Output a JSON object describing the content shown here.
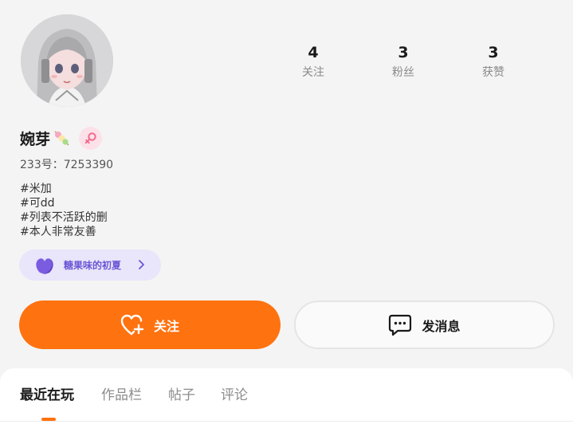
{
  "profile": {
    "name": "婉芽",
    "uid_label": "233号：7253390",
    "gender": "female",
    "tags": [
      "#米加",
      "#可dd",
      "#列表不活跃的删",
      "#本人非常友善"
    ]
  },
  "stats": [
    {
      "value": "4",
      "label": "关注"
    },
    {
      "value": "3",
      "label": "粉丝"
    },
    {
      "value": "3",
      "label": "获赞"
    }
  ],
  "fan_badge": {
    "label": "糖果味的初夏",
    "icon": "purple-heart-icon"
  },
  "actions": {
    "follow_label": "关注",
    "message_label": "发消息"
  },
  "tabs": [
    {
      "label": "最近在玩",
      "active": true
    },
    {
      "label": "作品栏",
      "active": false
    },
    {
      "label": "帖子",
      "active": false
    },
    {
      "label": "评论",
      "active": false
    }
  ],
  "colors": {
    "accent": "#ff7210",
    "badge_bg": "#e9e5fa",
    "badge_text": "#6b56d6",
    "gender_bg": "#fde1e8",
    "gender_icon": "#f06b8d"
  }
}
